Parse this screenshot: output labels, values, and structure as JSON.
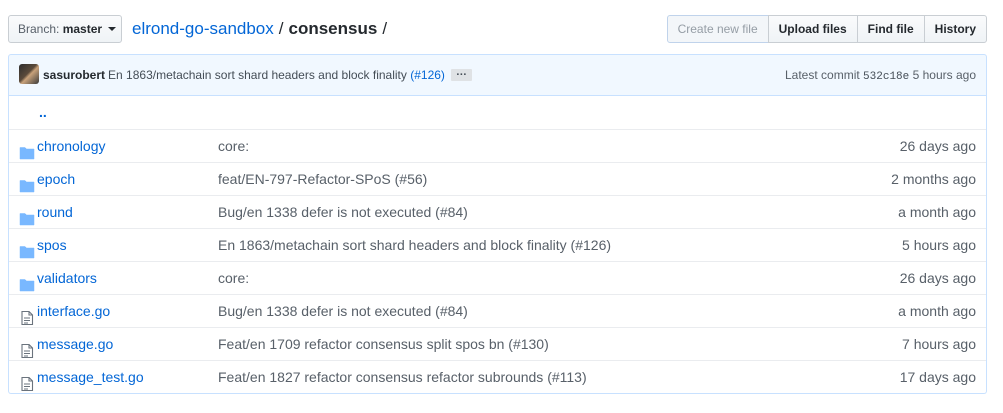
{
  "branch": {
    "prefix": "Branch:",
    "name": "master"
  },
  "breadcrumb": {
    "repo": "elrond-go-sandbox",
    "sep1": "/",
    "current": "consensus",
    "sep2": "/"
  },
  "actions": {
    "create_new_file": "Create new file",
    "upload_files": "Upload files",
    "find_file": "Find file",
    "history": "History"
  },
  "commit": {
    "author": "sasurobert",
    "message": "En 1863/metachain sort shard headers and block finality",
    "pr": "(#126)",
    "ellipsis": "…",
    "latest_label": "Latest commit",
    "sha": "532c18e",
    "age": "5 hours ago"
  },
  "parent_dir": "..",
  "files": [
    {
      "type": "dir",
      "icon": "folder-icon",
      "name": "chronology",
      "message": "core:",
      "age": "26 days ago"
    },
    {
      "type": "dir",
      "icon": "folder-icon",
      "name": "epoch",
      "message": "feat/EN-797-Refactor-SPoS (#56)",
      "age": "2 months ago"
    },
    {
      "type": "dir",
      "icon": "folder-icon",
      "name": "round",
      "message": "Bug/en 1338 defer is not executed (#84)",
      "age": "a month ago"
    },
    {
      "type": "dir",
      "icon": "folder-icon",
      "name": "spos",
      "message": "En 1863/metachain sort shard headers and block finality (#126)",
      "age": "5 hours ago"
    },
    {
      "type": "dir",
      "icon": "folder-icon",
      "name": "validators",
      "message": "core:",
      "age": "26 days ago"
    },
    {
      "type": "file",
      "icon": "file-icon",
      "name": "interface.go",
      "message": "Bug/en 1338 defer is not executed (#84)",
      "age": "a month ago"
    },
    {
      "type": "file",
      "icon": "file-icon",
      "name": "message.go",
      "message": "Feat/en 1709 refactor consensus split spos bn (#130)",
      "age": "7 hours ago"
    },
    {
      "type": "file",
      "icon": "file-icon",
      "name": "message_test.go",
      "message": "Feat/en 1827 refactor consensus refactor subrounds (#113)",
      "age": "17 days ago"
    }
  ],
  "colors": {
    "link": "#0366d6",
    "folder": "#79b8ff",
    "tease_bg": "#f1f8ff",
    "tease_border": "#c8e1ff"
  }
}
